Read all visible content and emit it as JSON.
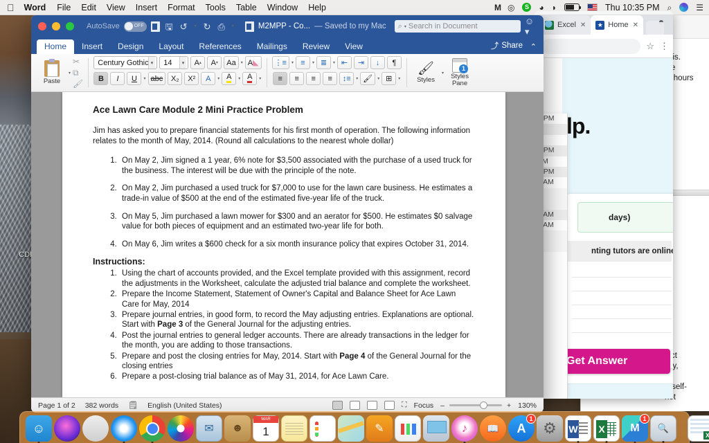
{
  "menubar": {
    "apple_icon": "apple-icon",
    "items": [
      "Word",
      "File",
      "Edit",
      "View",
      "Insert",
      "Format",
      "Tools",
      "Table",
      "Window",
      "Help"
    ],
    "status_icons": [
      "mail-icon",
      "circle-icon",
      "green-s-icon",
      "dropbox-icon",
      "wifi-icon",
      "battery-icon",
      "us-flag-icon"
    ],
    "time": "Thu 10:35 PM",
    "search_icon": "search-icon",
    "siri_icon": "siri-icon",
    "control_center_icon": "control-center-icon"
  },
  "desktop": {
    "icon_label": "CDR"
  },
  "word": {
    "titlebar": {
      "autosave_label": "AutoSave",
      "toggle_state": "OFF",
      "doc_icon": "document-icon",
      "save_icon": "save-icon",
      "undo_icon": "undo-icon",
      "redo_icon": "redo-icon",
      "print_icon": "print-icon",
      "more_icon": "more-icon",
      "doc_name": "M2MPP  -  Co...",
      "saved_status": "— Saved to my Mac",
      "search_placeholder": "Search in Document",
      "smiley_icon": "smiley-icon"
    },
    "tabs": [
      "Home",
      "Insert",
      "Design",
      "Layout",
      "References",
      "Mailings",
      "Review",
      "View"
    ],
    "active_tab": "Home",
    "share_label": "Share",
    "ribbon": {
      "paste_label": "Paste",
      "cut_icon": "scissors-icon",
      "copy_icon": "copy-icon",
      "format_painter_icon": "paintbrush-icon",
      "font_name": "Century Gothic",
      "font_size": "14",
      "grow_font": "A",
      "shrink_font": "A",
      "change_case": "Aa",
      "clear_formatting": "A",
      "bold": "B",
      "italic": "I",
      "underline": "U",
      "strikethrough": "abc",
      "subscript": "X2",
      "superscript": "X2",
      "text_effects": "A",
      "highlight": "A",
      "font_color": "A",
      "bullets_icon": "bullet-list-icon",
      "numbering_icon": "numbered-list-icon",
      "multilevel_icon": "multilevel-list-icon",
      "decrease_indent_icon": "decrease-indent-icon",
      "increase_indent_icon": "increase-indent-icon",
      "sort_icon": "sort-icon",
      "show_marks_icon": "paragraph-marks-icon",
      "align_left_icon": "align-left-icon",
      "align_center_icon": "align-center-icon",
      "align_right_icon": "align-right-icon",
      "justify_icon": "justify-icon",
      "line_spacing_icon": "line-spacing-icon",
      "shading_icon": "shading-icon",
      "borders_icon": "borders-icon",
      "styles_label": "Styles",
      "styles_pane_label": "Styles\nPane",
      "styles_pane_line1": "Styles",
      "styles_pane_line2": "Pane"
    },
    "document": {
      "title": "Ace Lawn Care Module 2 Mini Practice Problem",
      "intro": "Jim has asked you to prepare financial statements for his first month of operation.  The following information relates to the month of May, 2014. (Round all calculations to the nearest whole dollar)",
      "transactions": [
        "On May 2, Jim signed a 1 year, 6% note for $3,500 associated with the purchase of a used truck for the business. The interest will be due with the principle of the note.",
        "On May 2, Jim purchased a used truck for $7,000 to use for the lawn care business.  He estimates a trade-in value of $500 at the end of the estimated five-year life of the truck.",
        "On May 5, Jim purchased a lawn mower for $300 and an aerator for $500.  He estimates $0 salvage value for both pieces of equipment and an estimated two-year life for both.",
        "On May 6, Jim writes a $600 check for a six month insurance policy that expires October 31, 2014."
      ],
      "instructions_heading": "Instructions:",
      "instructions": [
        {
          "pre": "Using the chart of accounts provided, and the Excel template provided with this assignment, record the adjustments in the Worksheet, calculate the adjusted trial balance and complete the worksheet.",
          "bold": "",
          "post": ""
        },
        {
          "pre": "Prepare the Income Statement, Statement of Owner's Capital and Balance Sheet for Ace Lawn Care for May, 2014",
          "bold": "",
          "post": ""
        },
        {
          "pre": "Prepare journal entries, in good form, to record the May adjusting entries.  Explanations are optional. Start with ",
          "bold": "Page 3",
          "post": " of the General Journal for the adjusting entries."
        },
        {
          "pre": "Post the journal entries to general ledger accounts.  There are already transactions in the ledger for the month, you are adding to those transactions.",
          "bold": "",
          "post": ""
        },
        {
          "pre": "Prepare and post the closing entries for May, 2014.  Start with ",
          "bold": "Page 4",
          "post": " of the General Journal for the closing entries"
        },
        {
          "pre": "Prepare a post-closing trial balance as of May 31, 2014, for Ace Lawn Care.",
          "bold": "",
          "post": ""
        }
      ]
    },
    "status": {
      "page": "Page 1 of 2",
      "words": "382 words",
      "proofing_icon": "proofing-icon",
      "language": "English (United States)",
      "print_layout_icon": "print-layout-icon",
      "web_layout_icon": "web-layout-icon",
      "outline_icon": "outline-icon",
      "draft_icon": "draft-icon",
      "focus_label": "Focus",
      "zoom_out": "–",
      "zoom_in": "+",
      "zoom_level": "130%"
    }
  },
  "chrome": {
    "tabs": [
      {
        "label": "Excel",
        "favicon": "excel-favicon",
        "active": false
      },
      {
        "label": "Home",
        "favicon": "home-favicon",
        "active": true
      }
    ],
    "close_icon": "close-icon",
    "new_tab_icon": "new-tab-icon",
    "profile_icon": "profile-icon",
    "star_icon": "bookmark-star-icon",
    "menu_icon": "three-dot-menu-icon",
    "page": {
      "heading_fragment": "lp.",
      "green_box_fragment": "days)",
      "tutors_fragment": "nting tutors are online",
      "get_answer_label": "Get Answer",
      "time_options": [
        "0 PM",
        "M",
        "M",
        "0 PM",
        "PM",
        "8 PM",
        "5 AM",
        "",
        "",
        "4 AM",
        "5 AM",
        "",
        ""
      ]
    }
  },
  "background_window": {
    "search_placeholder": "Search",
    "text_fragments": [
      "ysis.",
      "ide",
      "of hours"
    ],
    "text_fragments2": [
      "dict",
      "ally,",
      "ng",
      "rt self-",
      "not"
    ]
  },
  "dock": {
    "items": [
      {
        "name": "finder",
        "cls": "d-finder",
        "running": true
      },
      {
        "name": "siri",
        "cls": "d-siri",
        "running": false
      },
      {
        "name": "launchpad",
        "cls": "d-launch",
        "running": false
      },
      {
        "name": "safari",
        "cls": "d-safari",
        "running": true
      },
      {
        "name": "chrome",
        "cls": "d-chrome",
        "running": true
      },
      {
        "name": "photos",
        "cls": "d-photos",
        "running": false
      },
      {
        "name": "mail",
        "cls": "d-mail",
        "running": false
      },
      {
        "name": "contacts",
        "cls": "d-contacts",
        "running": false
      },
      {
        "name": "calendar",
        "cls": "d-calendar",
        "running": false,
        "cal_month": "MAR",
        "cal_day": "1"
      },
      {
        "name": "notes",
        "cls": "d-notes",
        "running": false
      },
      {
        "name": "reminders",
        "cls": "d-reminders",
        "running": false
      },
      {
        "name": "maps",
        "cls": "d-maps",
        "running": false
      },
      {
        "name": "pages",
        "cls": "d-pages",
        "running": false
      },
      {
        "name": "numbers",
        "cls": "d-numbers",
        "running": false
      },
      {
        "name": "keynote",
        "cls": "d-keynote",
        "running": false
      },
      {
        "name": "itunes",
        "cls": "d-itunes",
        "running": true
      },
      {
        "name": "books",
        "cls": "d-books",
        "running": false
      },
      {
        "name": "app-store",
        "cls": "d-appstore",
        "running": false,
        "badge": "1"
      },
      {
        "name": "system-preferences",
        "cls": "d-syspref",
        "running": false
      },
      {
        "name": "word",
        "cls": "d-word",
        "running": true
      },
      {
        "name": "excel",
        "cls": "d-excel",
        "running": true
      },
      {
        "name": "gmail",
        "cls": "d-gmail",
        "running": true,
        "badge": "1"
      },
      {
        "name": "preview",
        "cls": "d-preview",
        "running": true
      }
    ],
    "minimized": [
      {
        "name": "minimized-excel-window-1",
        "cls": "d-minwin"
      },
      {
        "name": "minimized-excel-window-2",
        "cls": "d-minwin"
      }
    ],
    "trash": {
      "name": "trash",
      "cls": "d-trash"
    }
  }
}
